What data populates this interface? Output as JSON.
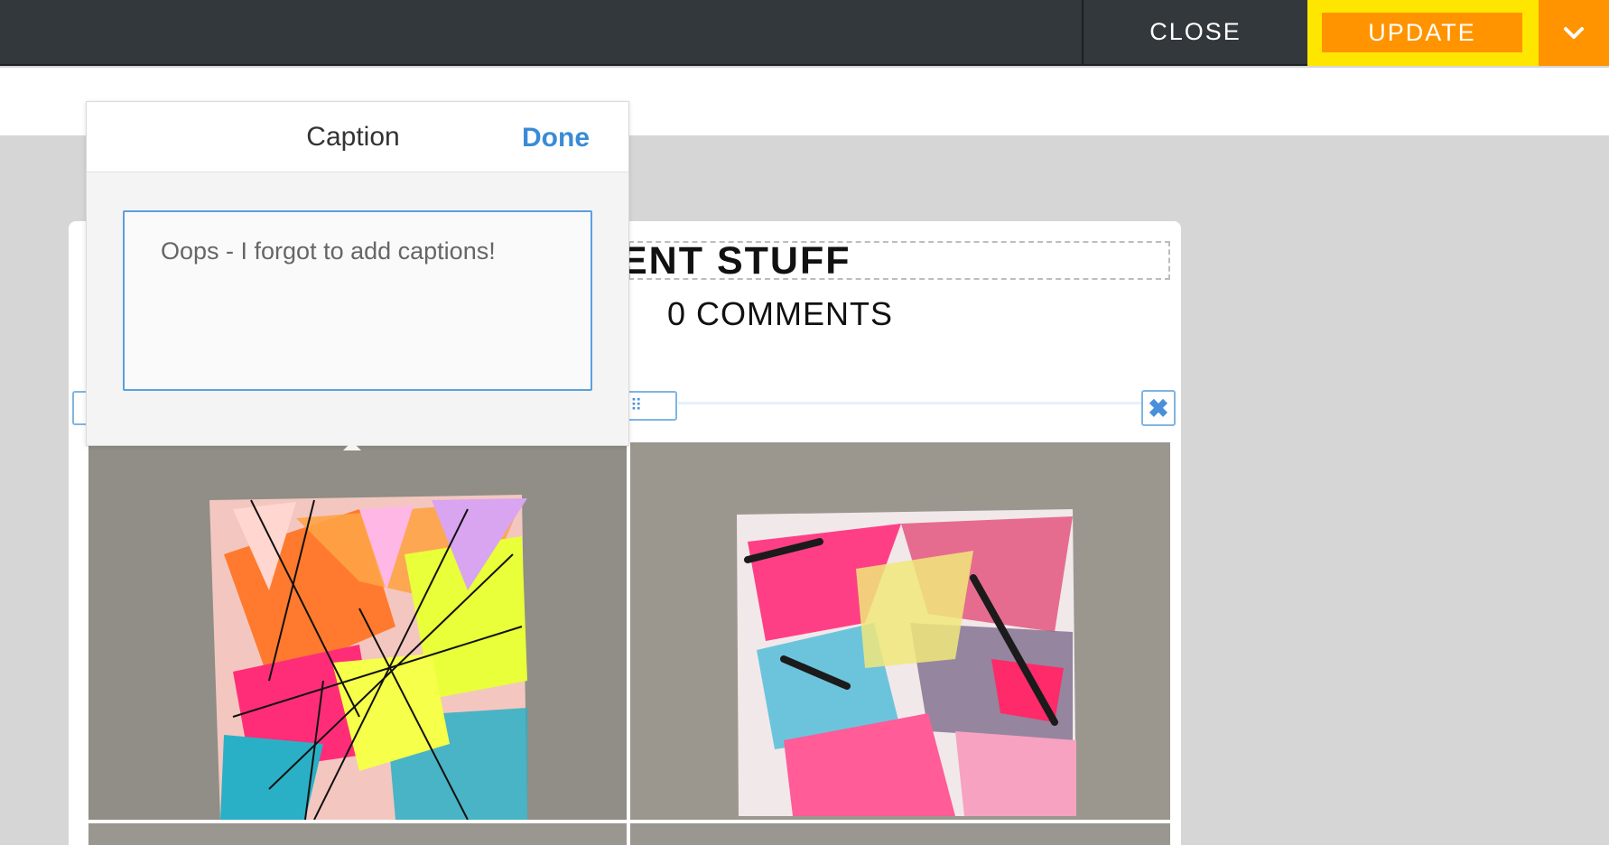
{
  "topbar": {
    "close_label": "CLOSE",
    "update_label": "UPDATE",
    "dropdown_icon": "chevron-down-icon",
    "accent_color": "#ff9400",
    "highlight_color": "#ffe600"
  },
  "post": {
    "title_visible": "ENT STUFF",
    "comments_label": "0 COMMENTS"
  },
  "gallery": {
    "handle_glyph": "⠿",
    "delete_glyph": "✖"
  },
  "caption_popover": {
    "title": "Caption",
    "done_label": "Done",
    "input_value": "Oops - I forgot to add captions!"
  }
}
